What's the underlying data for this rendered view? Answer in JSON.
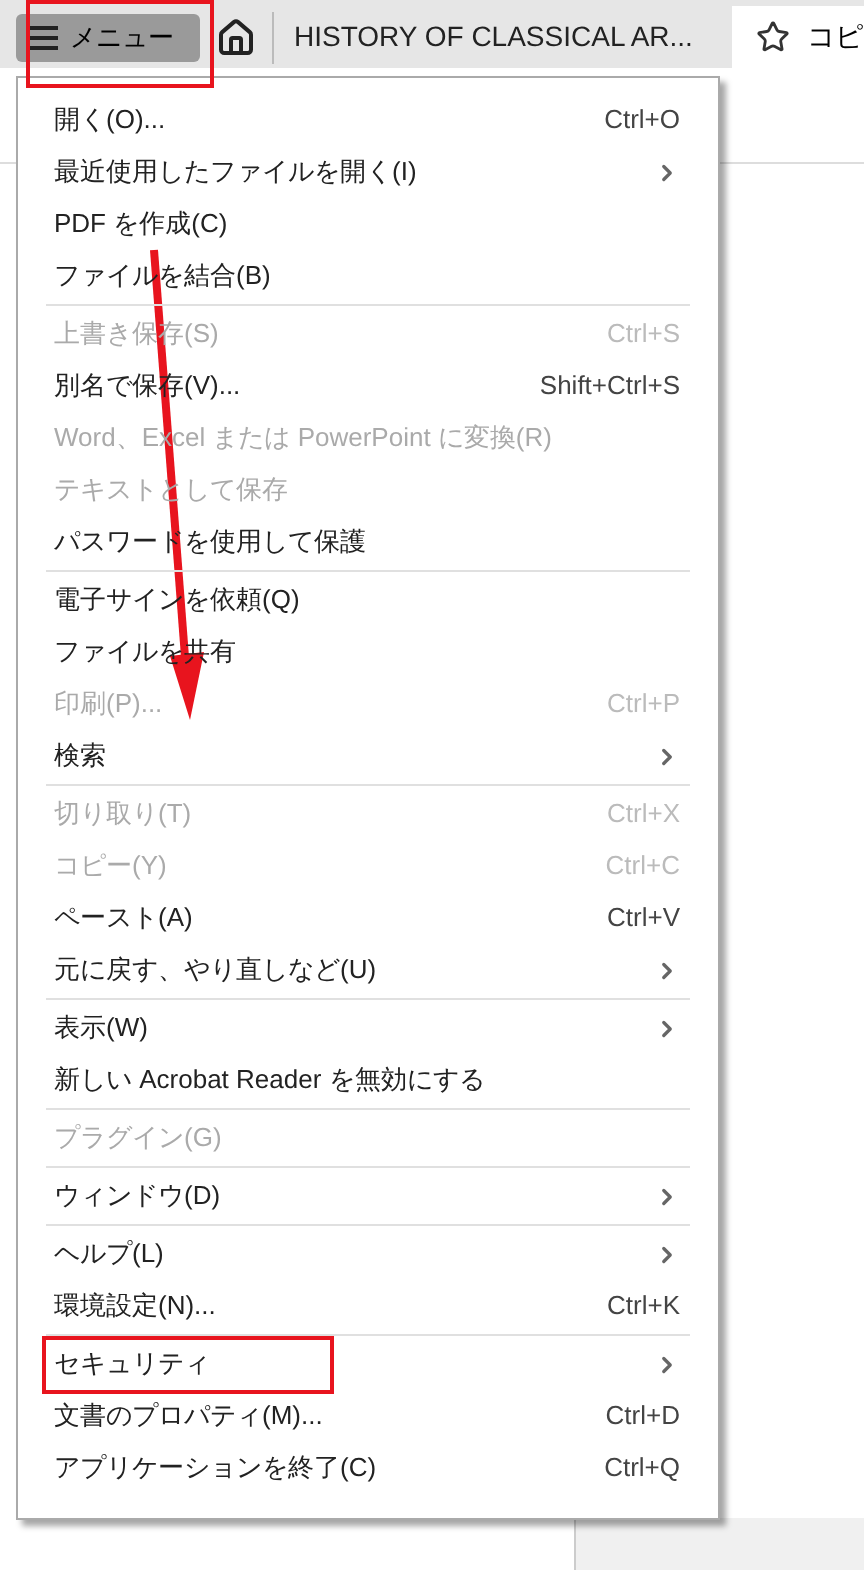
{
  "toolbar": {
    "menu_button": "メニュー",
    "tabs": [
      {
        "label": "HISTORY OF CLASSICAL AR...",
        "selected": false
      },
      {
        "label": "コピ",
        "selected": true
      }
    ]
  },
  "menu": [
    [
      {
        "label": "開く(O)...",
        "shortcut": "Ctrl+O",
        "submenu": false,
        "disabled": false
      },
      {
        "label": "最近使用したファイルを開く(I)",
        "submenu": true,
        "disabled": false
      },
      {
        "label": "PDF を作成(C)",
        "submenu": false,
        "disabled": false
      },
      {
        "label": "ファイルを結合(B)",
        "submenu": false,
        "disabled": false
      }
    ],
    [
      {
        "label": "上書き保存(S)",
        "shortcut": "Ctrl+S",
        "submenu": false,
        "disabled": true
      },
      {
        "label": "別名で保存(V)...",
        "shortcut": "Shift+Ctrl+S",
        "submenu": false,
        "disabled": false
      },
      {
        "label": "Word、Excel または PowerPoint に変換(R)",
        "submenu": false,
        "disabled": true
      },
      {
        "label": "テキストとして保存",
        "submenu": false,
        "disabled": true
      },
      {
        "label": "パスワードを使用して保護",
        "submenu": false,
        "disabled": false
      }
    ],
    [
      {
        "label": "電子サインを依頼(Q)",
        "submenu": false,
        "disabled": false
      },
      {
        "label": "ファイルを共有",
        "submenu": false,
        "disabled": false
      },
      {
        "label": "印刷(P)...",
        "shortcut": "Ctrl+P",
        "submenu": false,
        "disabled": true
      },
      {
        "label": "検索",
        "submenu": true,
        "disabled": false
      }
    ],
    [
      {
        "label": "切り取り(T)",
        "shortcut": "Ctrl+X",
        "submenu": false,
        "disabled": true
      },
      {
        "label": "コピー(Y)",
        "shortcut": "Ctrl+C",
        "submenu": false,
        "disabled": true
      },
      {
        "label": "ペースト(A)",
        "shortcut": "Ctrl+V",
        "submenu": false,
        "disabled": false
      },
      {
        "label": "元に戻す、やり直しなど(U)",
        "submenu": true,
        "disabled": false
      }
    ],
    [
      {
        "label": "表示(W)",
        "submenu": true,
        "disabled": false
      },
      {
        "label": "新しい Acrobat Reader を無効にする",
        "submenu": false,
        "disabled": false
      }
    ],
    [
      {
        "label": "プラグイン(G)",
        "submenu": false,
        "disabled": true
      }
    ],
    [
      {
        "label": "ウィンドウ(D)",
        "submenu": true,
        "disabled": false
      }
    ],
    [
      {
        "label": "ヘルプ(L)",
        "submenu": true,
        "disabled": false
      },
      {
        "label": "環境設定(N)...",
        "shortcut": "Ctrl+K",
        "submenu": false,
        "disabled": false
      }
    ],
    [
      {
        "label": "セキュリティ",
        "submenu": true,
        "disabled": false
      },
      {
        "label": "文書のプロパティ(M)...",
        "shortcut": "Ctrl+D",
        "submenu": false,
        "disabled": false
      },
      {
        "label": "アプリケーションを終了(C)",
        "shortcut": "Ctrl+Q",
        "submenu": false,
        "disabled": false
      }
    ]
  ]
}
